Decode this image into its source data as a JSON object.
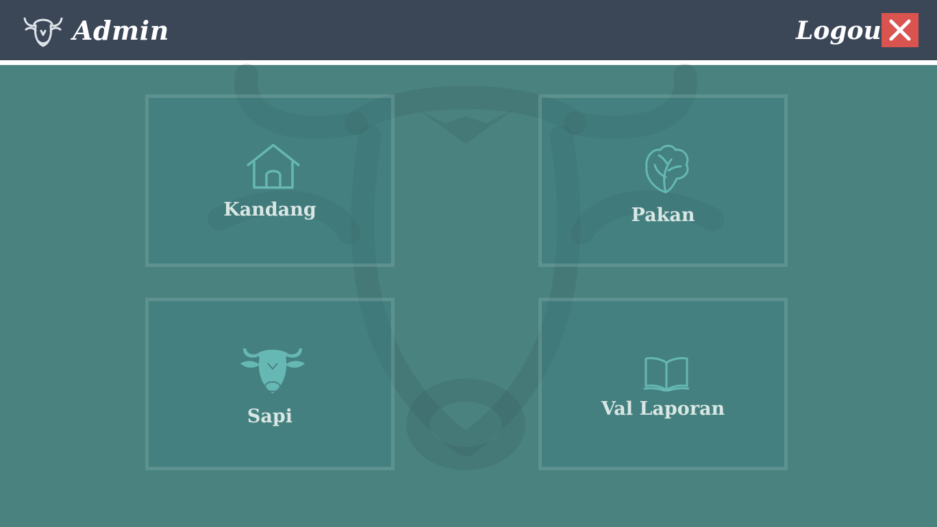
{
  "header": {
    "title": "Admin",
    "logo_icon": "bull-head-icon",
    "logout_label": "Logout",
    "logout_icon": "close-icon"
  },
  "menu": {
    "tiles": [
      {
        "label": "Kandang",
        "icon": "barn-house-icon"
      },
      {
        "label": "Pakan",
        "icon": "lettuce-leaf-icon"
      },
      {
        "label": "Sapi",
        "icon": "cow-head-icon"
      },
      {
        "label": "Val Laporan",
        "icon": "open-book-icon"
      }
    ]
  },
  "colors": {
    "header_bg": "#3b4657",
    "page_bg": "#4a8280",
    "icon_accent": "#66b8b4",
    "logout_button": "#d9534f"
  }
}
